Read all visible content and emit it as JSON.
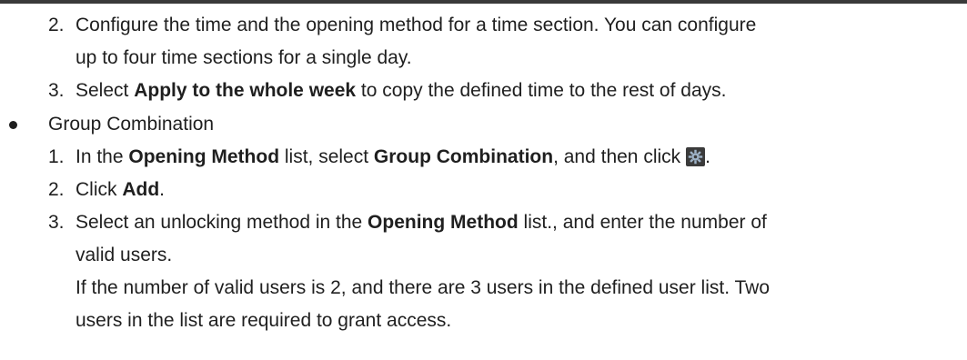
{
  "steps_time": {
    "step2_num": "2.",
    "step2_line1": "Configure the time and the opening method for a time section. You can configure",
    "step2_line2": "up to four time sections for a single day.",
    "step3_num": "3.",
    "step3_pre": "Select ",
    "step3_bold": "Apply to the whole week",
    "step3_post": " to copy the defined time to the rest of days."
  },
  "group_combination": {
    "bullet_label": "Group Combination",
    "step1_num": "1.",
    "step1_pre": "In the ",
    "step1_bold1": "Opening Method",
    "step1_mid1": " list, select ",
    "step1_bold2": "Group Combination",
    "step1_mid2": ", and then click",
    "step1_post": ".",
    "step2_num": "2.",
    "step2_pre": "Click ",
    "step2_bold": "Add",
    "step2_post": ".",
    "step3_num": "3.",
    "step3_pre": "Select an unlocking method in the ",
    "step3_bold": "Opening Method",
    "step3_post": " list., and enter the number of",
    "step3_line2": "valid users.",
    "note_line1": "If the number of valid users is 2, and there are 3 users in the defined user list. Two",
    "note_line2": "users in the list are required to grant access."
  },
  "icons": {
    "settings_button_icon": "gear-icon"
  }
}
